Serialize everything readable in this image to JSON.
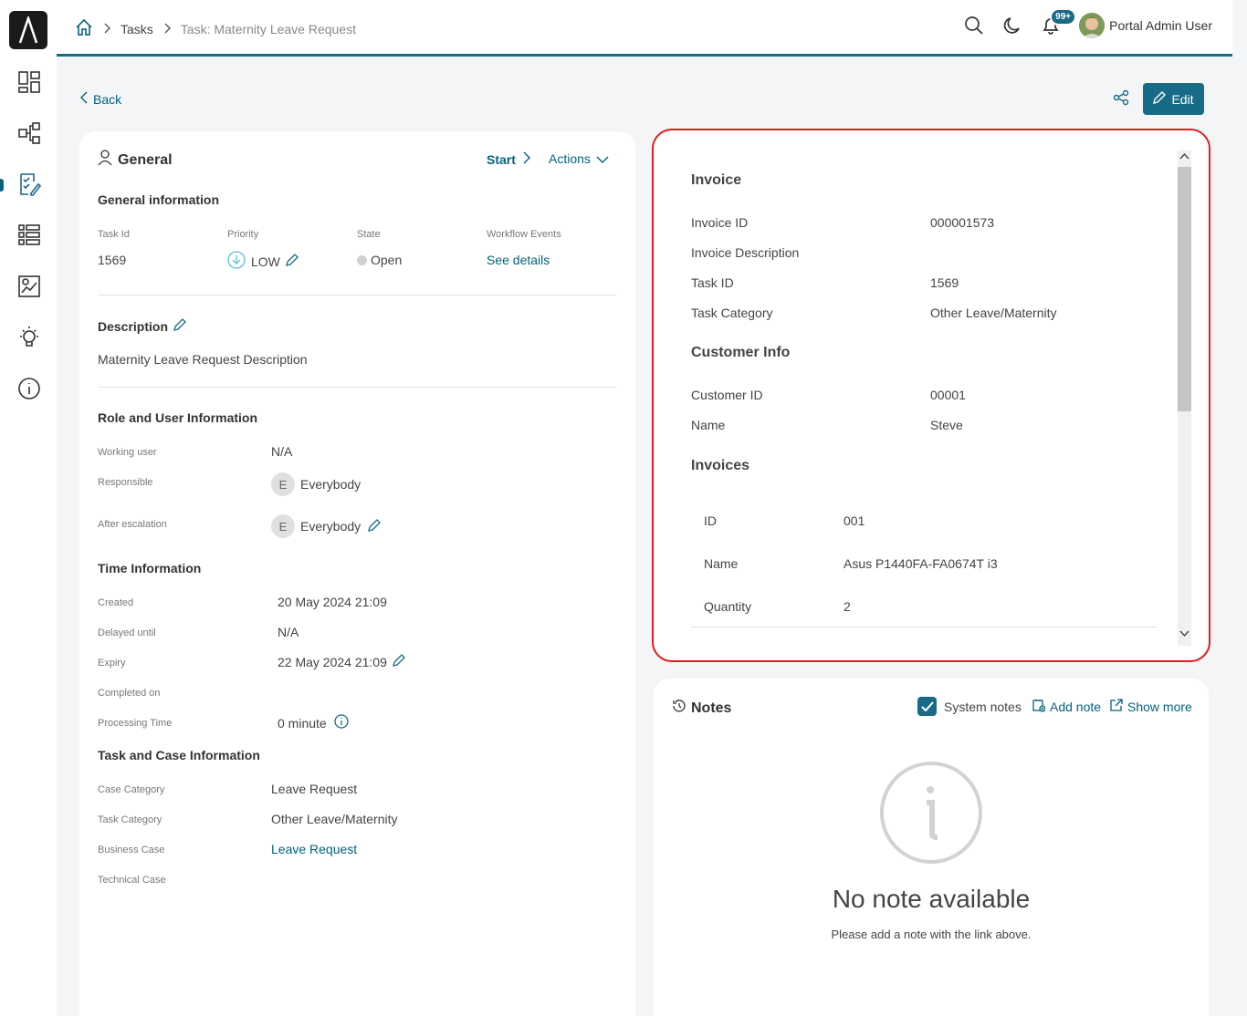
{
  "breadcrumb": {
    "home_icon": "home-icon",
    "item1": "Tasks",
    "item2": "Task: Maternity Leave Request"
  },
  "header": {
    "notif_count": "99+",
    "user_name": "Portal Admin User"
  },
  "toolbar": {
    "back_label": "Back",
    "edit_label": "Edit"
  },
  "general": {
    "title": "General",
    "start_label": "Start",
    "actions_label": "Actions",
    "general_info_title": "General information",
    "task_id_label": "Task Id",
    "task_id": "1569",
    "priority_label": "Priority",
    "priority": "LOW",
    "state_label": "State",
    "state": "Open",
    "workflow_label": "Workflow Events",
    "workflow_link": "See details",
    "description_title": "Description",
    "description": "Maternity Leave Request Description",
    "role_title": "Role and User Information",
    "working_user_label": "Working user",
    "working_user": "N/A",
    "responsible_label": "Responsible",
    "responsible_initial": "E",
    "responsible": "Everybody",
    "after_escalation_label": "After escalation",
    "after_escalation_initial": "E",
    "after_escalation": "Everybody",
    "time_title": "Time Information",
    "created_label": "Created",
    "created": "20 May 2024 21:09",
    "delayed_label": "Delayed until",
    "delayed": "N/A",
    "expiry_label": "Expiry",
    "expiry": "22 May 2024 21:09",
    "completed_label": "Completed on",
    "processing_label": "Processing Time",
    "processing": "0 minute",
    "taskcase_title": "Task and Case Information",
    "case_category_label": "Case Category",
    "case_category": "Leave Request",
    "task_category_label": "Task Category",
    "task_category": "Other Leave/Maternity",
    "business_case_label": "Business Case",
    "business_case": "Leave Request",
    "technical_case_label": "Technical Case"
  },
  "invoice": {
    "title": "Invoice",
    "invoice_id_label": "Invoice ID",
    "invoice_id": "000001573",
    "invoice_desc_label": "Invoice Description",
    "task_id_label": "Task ID",
    "task_id": "1569",
    "task_category_label": "Task Category",
    "task_category": "Other Leave/Maternity",
    "customer_title": "Customer Info",
    "customer_id_label": "Customer ID",
    "customer_id": "00001",
    "name_label": "Name",
    "name": "Steve",
    "invoices_title": "Invoices",
    "items": [
      {
        "id_label": "ID",
        "id": "001",
        "name_label": "Name",
        "name": "Asus P1440FA-FA0674T i3",
        "qty_label": "Quantity",
        "qty": "2"
      }
    ]
  },
  "notes": {
    "title": "Notes",
    "system_notes_label": "System notes",
    "add_note_label": "Add note",
    "show_more_label": "Show more",
    "empty_title": "No note available",
    "empty_sub": "Please add a note with the link above."
  },
  "colors": {
    "accent": "#176b87",
    "link": "#00647d",
    "highlight_border": "#e11d1d"
  }
}
